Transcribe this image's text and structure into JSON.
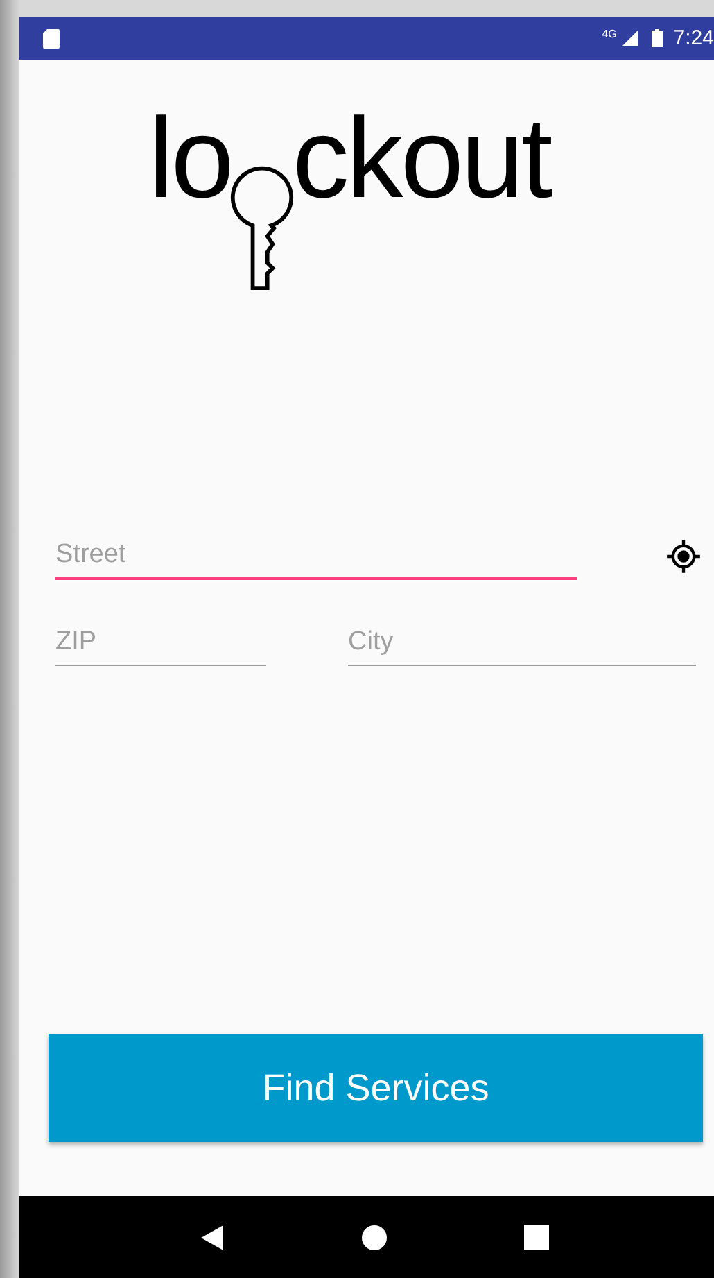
{
  "status_bar": {
    "network": "4G",
    "time": "7:24"
  },
  "logo": {
    "before_key": "lo",
    "after_key": "ckout"
  },
  "fields": [
    {
      "placeholder": "Street",
      "focused": true
    },
    {
      "placeholder": "ZIP",
      "focused": false
    },
    {
      "placeholder": "City",
      "focused": false
    }
  ],
  "button": "Find Services"
}
